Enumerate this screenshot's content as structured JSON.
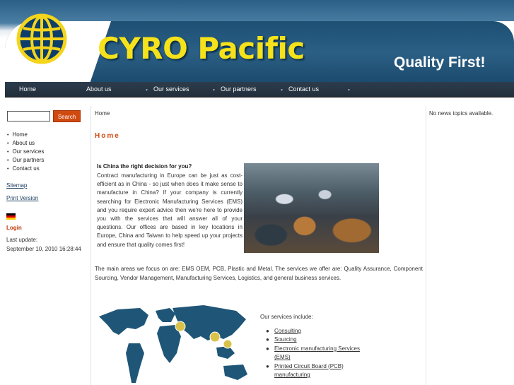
{
  "header": {
    "title": "CYRO Pacific",
    "slogan": "Quality First!"
  },
  "nav": {
    "items": [
      {
        "label": "Home"
      },
      {
        "label": "About us"
      },
      {
        "label": "Our services"
      },
      {
        "label": "Our partners"
      },
      {
        "label": "Contact us"
      }
    ]
  },
  "sidebar": {
    "search_button": "Search",
    "search_value": "",
    "menu": [
      "Home",
      "About us",
      "Our services",
      "Our partners",
      "Contact us"
    ],
    "sitemap": "Sitemap",
    "print": "Print Version",
    "login": "Login",
    "last_update_label": "Last update:",
    "last_update_value": "September 10, 2010 16:28:44"
  },
  "main": {
    "breadcrumb": "Home",
    "heading": "Home",
    "intro_title": "Is China the right decision for you?",
    "intro_text": "Contract manufacturing in Europe can be just as cost-efficient as in China - so just when does it make sense to manufacture in China? If your company is currently searching for Electronic Manufacturing Services (EMS) and you require expert advice then we're here to provide you with the services that will answer all of your questions. Our offices are based in key locations in Europe, China and Taiwan to help speed up your projects and ensure that quality comes first!",
    "areas_text": "The main areas we focus on are: EMS OEM, PCB, Plastic and Metal. The services we offer are: Quality Assurance, Component Sourcing, Vendor Management, Manufacturing Services, Logistics, and general business services.",
    "services_title": "Our services include:",
    "services": [
      {
        "line1": "Consulting",
        "line2": ""
      },
      {
        "line1": "Sourcing",
        "line2": ""
      },
      {
        "line1": "Electronic manufacturing Services",
        "line2": "(EMS)"
      },
      {
        "line1": "Printed Circuit Board (PCB)",
        "line2": "manufacturing"
      }
    ]
  },
  "right": {
    "news": "No news topics available."
  },
  "colors": {
    "brand_blue": "#2b5f84",
    "title_yellow": "#f5e21a",
    "accent_orange": "#d04a10"
  }
}
